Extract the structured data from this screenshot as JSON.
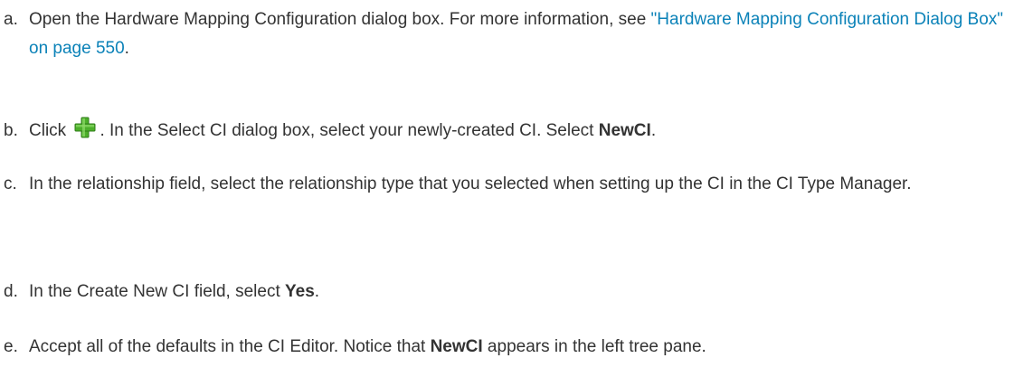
{
  "steps": [
    {
      "marker": "a.",
      "pre": "Open the Hardware Mapping Configuration dialog box. For more information, see ",
      "link": "\"Hardware Mapping Configuration Dialog Box\" on page 550",
      "post": "."
    },
    {
      "marker": "b.",
      "pre": "Click ",
      "icon": "add-plus-icon",
      "mid": ". In the Select CI dialog box, select your newly-created CI. Select ",
      "bold": "NewCI",
      "post": "."
    },
    {
      "marker": "c.",
      "text": "In the relationship field, select the relationship type that you selected when setting up the CI in the CI Type Manager."
    },
    {
      "marker": "d.",
      "pre": "In the Create New CI field, select ",
      "bold": "Yes",
      "post": "."
    },
    {
      "marker": "e.",
      "pre": "Accept all of the defaults in the CI Editor. Notice that ",
      "bold": "NewCI",
      "post": " appears in the left tree pane."
    }
  ],
  "colors": {
    "text": "#333333",
    "link": "#0b82b8",
    "icon_green": "#4caf2a"
  }
}
